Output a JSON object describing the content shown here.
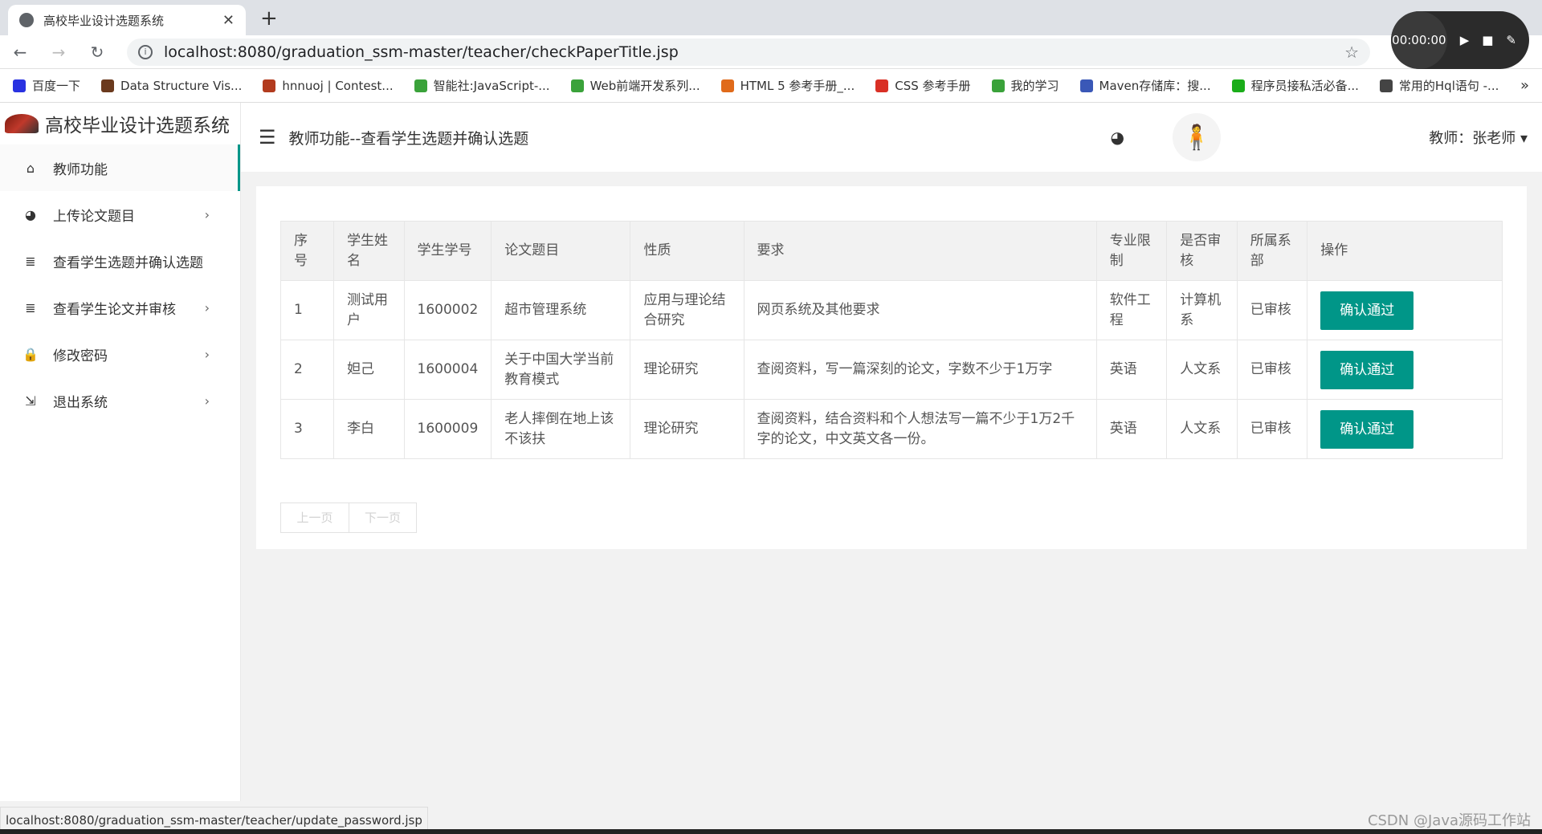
{
  "browser": {
    "tab_title": "高校毕业设计选题系统",
    "tab_close": "✕",
    "new_tab": "+",
    "url": "localhost:8080/graduation_ssm-master/teacher/checkPaperTitle.jsp",
    "recorder_time": "00:00:00",
    "bookmarks": [
      {
        "label": "百度一下",
        "color": "#2932e1"
      },
      {
        "label": "Data Structure Vis...",
        "color": "#6b3a1e"
      },
      {
        "label": "hnnuoj | Contest...",
        "color": "#b23b1e"
      },
      {
        "label": "智能社:JavaScript-...",
        "color": "#3aa23a"
      },
      {
        "label": "Web前端开发系列...",
        "color": "#3aa23a"
      },
      {
        "label": "HTML 5 参考手册_...",
        "color": "#e06a1a"
      },
      {
        "label": "CSS 参考手册",
        "color": "#d93025"
      },
      {
        "label": "我的学习",
        "color": "#3aa23a"
      },
      {
        "label": "Maven存储库：搜...",
        "color": "#3a58b7"
      },
      {
        "label": "程序员接私活必备...",
        "color": "#1aad19"
      },
      {
        "label": "常用的Hql语句 -...",
        "color": "#444444"
      }
    ],
    "status_url": "localhost:8080/graduation_ssm-master/teacher/update_password.jsp"
  },
  "app": {
    "title": "高校毕业设计选题系统",
    "breadcrumb": "教师功能--查看学生选题并确认选题",
    "user_label": "教师：张老师 ▾"
  },
  "sidebar": {
    "items": [
      {
        "label": "教师功能",
        "icon": "home-icon",
        "glyph": "⌂",
        "arrow": ""
      },
      {
        "label": "上传论文题目",
        "icon": "palette-icon",
        "glyph": "◕",
        "arrow": "›"
      },
      {
        "label": "查看学生选题并确认选题",
        "icon": "list-icon",
        "glyph": "≣",
        "arrow": ""
      },
      {
        "label": "查看学生论文并审核",
        "icon": "list-icon",
        "glyph": "≣",
        "arrow": "›"
      },
      {
        "label": "修改密码",
        "icon": "lock-icon",
        "glyph": "🔒",
        "arrow": "›"
      },
      {
        "label": "退出系统",
        "icon": "logout-icon",
        "glyph": "⇲",
        "arrow": "›"
      }
    ]
  },
  "table": {
    "headers": [
      "序号",
      "学生姓名",
      "学生学号",
      "论文题目",
      "性质",
      "要求",
      "专业限制",
      "是否审核",
      "所属系部",
      "操作"
    ],
    "rows": [
      [
        "1",
        "测试用户",
        "1600002",
        "超市管理系统",
        "应用与理论结合研究",
        "网页系统及其他要求",
        "软件工程",
        "计算机系",
        "已审核",
        "确认通过"
      ],
      [
        "2",
        "妲己",
        "1600004",
        "关于中国大学当前教育模式",
        "理论研究",
        "查阅资料，写一篇深刻的论文，字数不少于1万字",
        "英语",
        "人文系",
        "已审核",
        "确认通过"
      ],
      [
        "3",
        "李白",
        "1600009",
        "老人摔倒在地上该不该扶",
        "理论研究",
        "查阅资料，结合资料和个人想法写一篇不少于1万2千字的论文，中文英文各一份。",
        "英语",
        "人文系",
        "已审核",
        "确认通过"
      ]
    ]
  },
  "pager": {
    "prev": "上一页",
    "next": "下一页"
  },
  "watermark": "CSDN @Java源码工作站",
  "colors": {
    "accent": "#009688"
  }
}
